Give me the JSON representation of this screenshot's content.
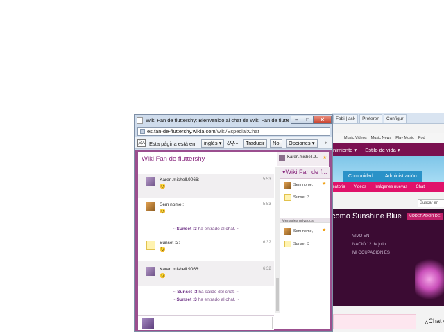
{
  "background_browser": {
    "tabs": [
      "Fabi | ask",
      "Preferen",
      "Configur"
    ],
    "bookmarks": [
      "Music Videos",
      "Music News",
      "Play Music",
      "Pod"
    ],
    "wiki_nav": [
      "nimiento ▾",
      "Estilo de vida ▾"
    ],
    "wiki_tabs": [
      "Comunidad",
      "Administración"
    ],
    "sub_nav": [
      "leatoria",
      "Videos",
      "Imágenes nuevas",
      "Chat"
    ],
    "search_placeholder": "Buscar en ",
    "heading": "como Sunshine Blue",
    "badge": "MODERADOR DE",
    "info": [
      "VIVO EN",
      "NACIÓ 12 de julio",
      "MI OCUPACIÓN ES"
    ],
    "chat_question": "¿Chat e"
  },
  "window": {
    "title": "Wiki Fan de fluttershy: Bienvenido al chat de Wiki Fan de fluttershy...",
    "controls": {
      "minimize": "–",
      "maximize": "□",
      "close": "✕"
    },
    "url_domain": "es.fan-de-fluttershy.wikia.com",
    "url_path": "/wiki/Especial:Chat"
  },
  "translate_bar": {
    "text": "Esta página está en",
    "language": "inglés ▾",
    "ask": "¿Q...",
    "translate": "Traducir",
    "no": "No",
    "options": "Opciones ▾",
    "close": "×"
  },
  "chat": {
    "room_title": "Wiki Fan de fluttershy",
    "self_user": "Karen.mishell.9...",
    "rail_title": "▾Wiki Fan de f...",
    "rail_users": [
      "Sem nome,",
      "Sunset :3"
    ],
    "private_header": "Mensajes privados",
    "private_users": [
      "Sem nome,",
      "Sunset :3"
    ],
    "messages": [
      {
        "user": "Karen.mishell.9066:",
        "text": "😊",
        "time": "5:53"
      },
      {
        "user": "Sem nome,:",
        "text": "😊",
        "time": "5:53"
      },
      {
        "inline_user": "Sunset :3",
        "inline_text": " ha entrado al chat. ~"
      },
      {
        "user": "Sunset :3:",
        "text": "😉",
        "time": "6:32"
      },
      {
        "user": "Karen.mishell.9066:",
        "text": "😉",
        "time": "6:32"
      },
      {
        "inline_user": "Sunset :3",
        "inline_text": " ha salido del chat. ~"
      },
      {
        "inline_user": "Sunset :3",
        "inline_text": " ha entrado al chat. ~"
      }
    ],
    "inline_prefix": "~ "
  },
  "colors": {
    "chat_frame": "#9b4f8f",
    "room_title": "#8a2a7f",
    "wiki_nav": "#7a1050",
    "sub_nav": "#e0126a",
    "star": "#f0a21a"
  }
}
